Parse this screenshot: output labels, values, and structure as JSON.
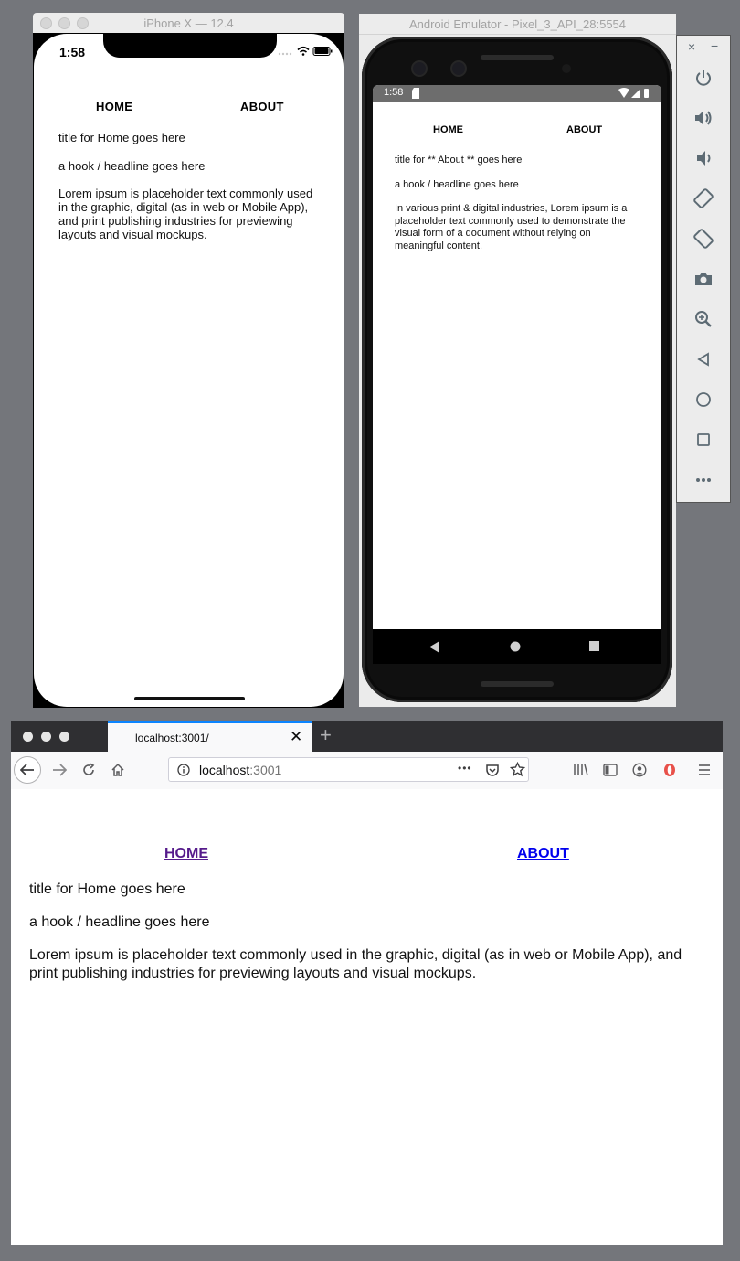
{
  "ios_window": {
    "title": "iPhone X — 12.4",
    "status_time": "1:58",
    "nav": {
      "home": "HOME",
      "about": "ABOUT"
    },
    "page_title": "title for Home goes here",
    "hook": "a hook / headline goes here",
    "body": "Lorem ipsum is placeholder text commonly used in the graphic, digital (as in web or Mobile App), and print publishing industries for previewing layouts and visual mockups."
  },
  "android_window": {
    "title": "Android Emulator - Pixel_3_API_28:5554",
    "status_time": "1:58",
    "nav": {
      "home": "HOME",
      "about": "ABOUT"
    },
    "page_title": "title for ** About ** goes here",
    "hook": "a hook / headline goes here",
    "body": "In various print & digital industries, Lorem ipsum is a placeholder text commonly used to demonstrate the visual form of a document without relying on meaningful content."
  },
  "emulator_controls": {
    "close": "×",
    "minimize": "−",
    "buttons": [
      "power-icon",
      "volume-up-icon",
      "volume-down-icon",
      "rotate-left-icon",
      "rotate-right-icon",
      "camera-icon",
      "zoom-icon",
      "back-icon",
      "home-icon",
      "overview-icon",
      "more-icon"
    ]
  },
  "firefox_window": {
    "tab_title": "localhost:3001/",
    "tab_close": "✕",
    "new_tab": "+",
    "url_host": "localhost",
    "url_port": ":3001",
    "url_more": "•••",
    "nav": {
      "home": "HOME",
      "about": "ABOUT"
    },
    "page_title": "title for Home goes here",
    "hook": "a hook / headline goes here",
    "body": "Lorem ipsum is placeholder text commonly used in the graphic, digital (as in web or Mobile App), and print publishing industries for previewing layouts and visual mockups.",
    "colors": {
      "visited_link": "#551a8b",
      "link": "#0000ee",
      "accent": "#0a84ff"
    }
  }
}
